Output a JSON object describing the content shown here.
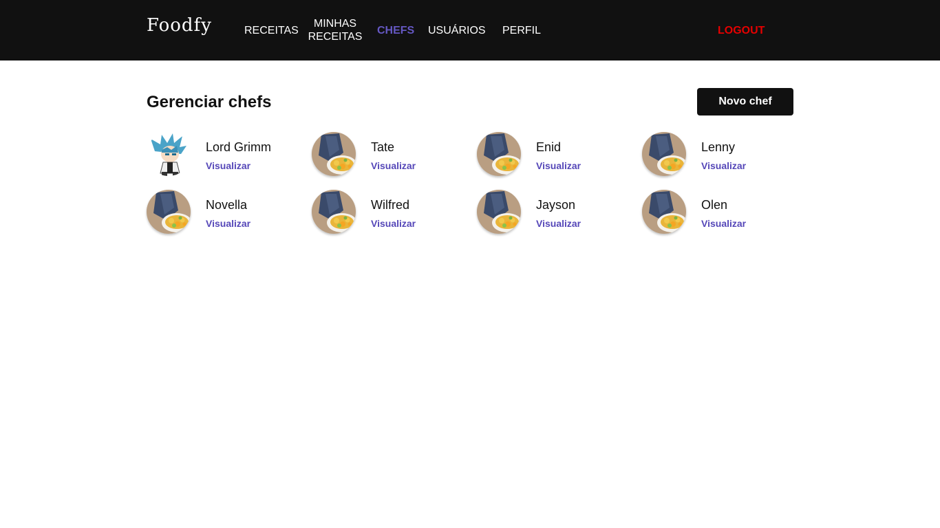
{
  "header": {
    "logo": "Foodfy",
    "nav": {
      "receitas": "RECEITAS",
      "minhas_receitas": "MINHAS RECEITAS",
      "chefs": "CHEFS",
      "usuarios": "USUÁRIOS",
      "perfil": "PERFIL"
    },
    "logout": "LOGOUT",
    "active_color": "#6558c3",
    "logout_color": "#e60000"
  },
  "main": {
    "title": "Gerenciar chefs",
    "new_button": "Novo chef",
    "view_label": "Visualizar",
    "chefs": [
      {
        "name": "Lord Grimm",
        "avatar": "anime-character-avatar"
      },
      {
        "name": "Tate",
        "avatar": "food-dish-avatar"
      },
      {
        "name": "Enid",
        "avatar": "food-dish-avatar"
      },
      {
        "name": "Lenny",
        "avatar": "food-dish-avatar"
      },
      {
        "name": "Novella",
        "avatar": "food-dish-avatar"
      },
      {
        "name": "Wilfred",
        "avatar": "food-dish-avatar"
      },
      {
        "name": "Jayson",
        "avatar": "food-dish-avatar"
      },
      {
        "name": "Olen",
        "avatar": "food-dish-avatar"
      }
    ]
  }
}
